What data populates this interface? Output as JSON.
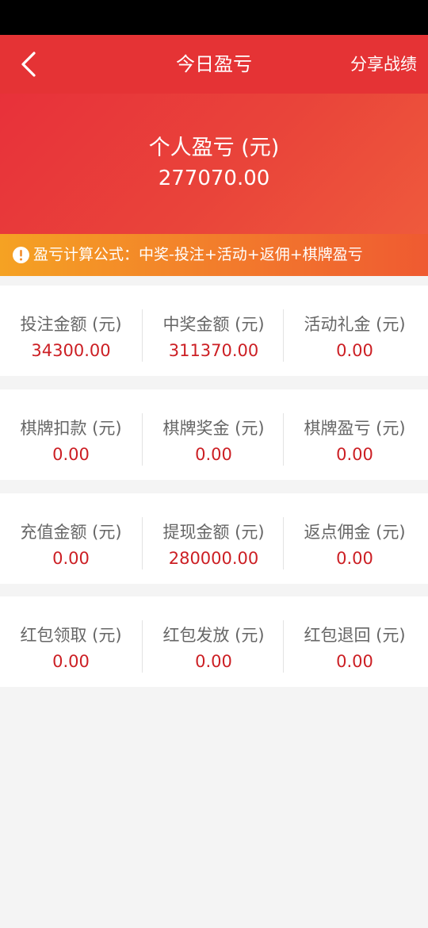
{
  "header": {
    "title": "今日盈亏",
    "share_label": "分享战绩",
    "back_icon": "chevron-left-icon"
  },
  "summary": {
    "label": "个人盈亏 (元)",
    "value": "277070.00"
  },
  "formula": {
    "icon": "exclamation-circle-icon",
    "text": "盈亏计算公式：中奖-投注+活动+返佣+棋牌盈亏"
  },
  "stats": [
    [
      {
        "label": "投注金额 (元)",
        "value": "34300.00"
      },
      {
        "label": "中奖金额 (元)",
        "value": "311370.00"
      },
      {
        "label": "活动礼金 (元)",
        "value": "0.00"
      }
    ],
    [
      {
        "label": "棋牌扣款 (元)",
        "value": "0.00"
      },
      {
        "label": "棋牌奖金 (元)",
        "value": "0.00"
      },
      {
        "label": "棋牌盈亏 (元)",
        "value": "0.00"
      }
    ],
    [
      {
        "label": "充值金额 (元)",
        "value": "0.00"
      },
      {
        "label": "提现金额 (元)",
        "value": "280000.00"
      },
      {
        "label": "返点佣金 (元)",
        "value": "0.00"
      }
    ],
    [
      {
        "label": "红包领取 (元)",
        "value": "0.00"
      },
      {
        "label": "红包发放 (元)",
        "value": "0.00"
      },
      {
        "label": "红包退回 (元)",
        "value": "0.00"
      }
    ]
  ],
  "colors": {
    "nav_red": "#e53335",
    "value_red": "#cc1f24",
    "formula_orange": "#f5a223",
    "page_bg": "#f4f4f4"
  }
}
